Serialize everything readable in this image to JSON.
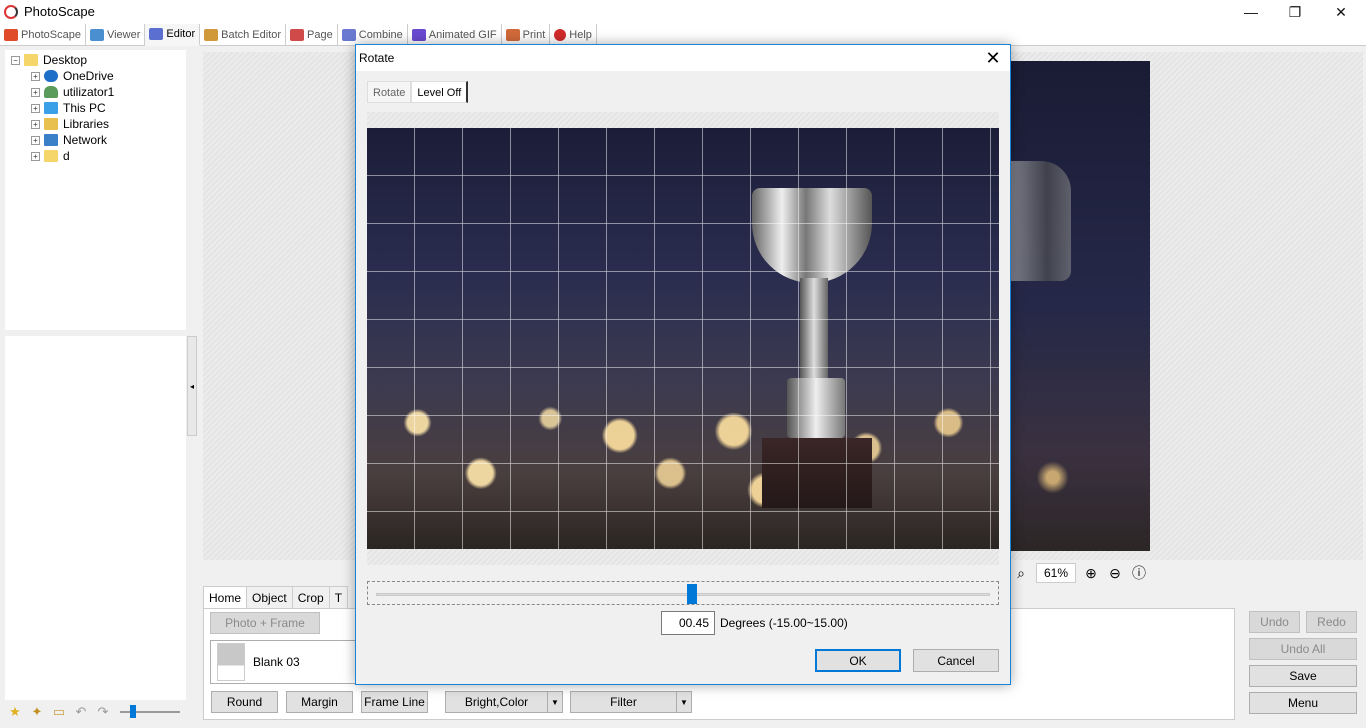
{
  "window": {
    "title": "PhotoScape",
    "minimize": "—",
    "restore": "❐",
    "close": "✕"
  },
  "main_tabs": [
    {
      "label": "PhotoScape",
      "color": "#e04b2c"
    },
    {
      "label": "Viewer",
      "color": "#4a8fd0"
    },
    {
      "label": "Editor",
      "color": "#5a6fd0"
    },
    {
      "label": "Batch Editor",
      "color": "#d09a3a"
    },
    {
      "label": "Page",
      "color": "#d04a4a"
    },
    {
      "label": "Combine",
      "color": "#6a7ad0"
    },
    {
      "label": "Animated GIF",
      "color": "#6a4ad0"
    },
    {
      "label": "Print",
      "color": "#d06a3a"
    },
    {
      "label": "Help",
      "color": "#d02a2a"
    }
  ],
  "tree": {
    "root": "Desktop",
    "items": [
      "OneDrive",
      "utilizator1",
      "This PC",
      "Libraries",
      "Network",
      "d"
    ]
  },
  "zoom": {
    "value": "61%"
  },
  "edit_tabs": [
    "Home",
    "Object",
    "Crop",
    "T"
  ],
  "home_panel": {
    "photo_frame": "Photo + Frame",
    "frame_name": "Blank 03",
    "round": "Round",
    "margin": "Margin",
    "frame_line": "Frame Line",
    "bright_color": "Bright,Color",
    "filter": "Filter"
  },
  "right_buttons": {
    "undo": "Undo",
    "redo": "Redo",
    "undo_all": "Undo All",
    "save": "Save",
    "menu": "Menu"
  },
  "dialog": {
    "title": "Rotate",
    "tabs": [
      "Rotate",
      "Level Off"
    ],
    "degrees_value": "00.45",
    "degrees_label": "Degrees (-15.00~15.00)",
    "slider_fraction": 0.515,
    "ok": "OK",
    "cancel": "Cancel"
  }
}
